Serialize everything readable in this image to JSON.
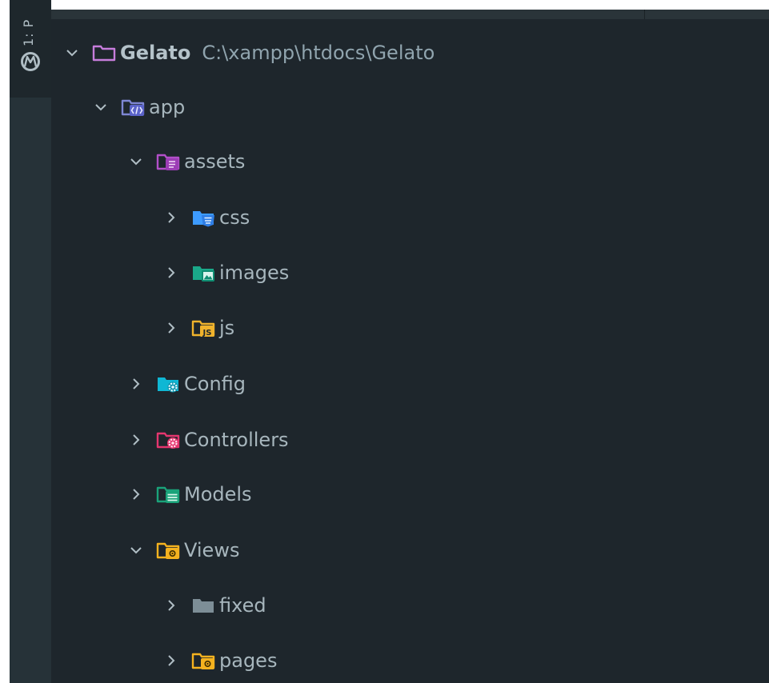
{
  "sidebar": {
    "tab_label": "1: P",
    "colors": {
      "bg": "#263238",
      "icon": "#b0bec5"
    }
  },
  "tree": {
    "colors": {
      "bg": "#1e262c",
      "text": "#a7b6bd",
      "chevron": "#b0bec5"
    },
    "root": {
      "name": "Gelato",
      "path": "C:\\xampp\\htdocs\\Gelato",
      "expanded": true,
      "icon": "folder-outline-icon",
      "icon_color": "#c77ddc"
    },
    "items": [
      {
        "name": "app",
        "expanded": true,
        "icon": "code-folder-icon",
        "icon_color": "#7e86d4"
      },
      {
        "name": "assets",
        "expanded": true,
        "icon": "assets-folder-icon",
        "icon_color": "#b24fc9"
      },
      {
        "name": "css",
        "expanded": false,
        "icon": "css-folder-icon",
        "icon_color": "#3d9bff"
      },
      {
        "name": "images",
        "expanded": false,
        "icon": "images-folder-icon",
        "icon_color": "#1aa889"
      },
      {
        "name": "js",
        "expanded": false,
        "icon": "js-folder-icon",
        "icon_color": "#f0b32c"
      },
      {
        "name": "Config",
        "expanded": false,
        "icon": "config-folder-icon",
        "icon_color": "#0fb7d4"
      },
      {
        "name": "Controllers",
        "expanded": false,
        "icon": "controllers-folder-icon",
        "icon_color": "#e4366f"
      },
      {
        "name": "Models",
        "expanded": false,
        "icon": "models-folder-icon",
        "icon_color": "#1aa37a"
      },
      {
        "name": "Views",
        "expanded": true,
        "icon": "views-folder-icon",
        "icon_color": "#f5b21f"
      },
      {
        "name": "fixed",
        "expanded": false,
        "icon": "folder-icon",
        "icon_color": "#7d8e97"
      },
      {
        "name": "pages",
        "expanded": false,
        "icon": "views-folder-icon",
        "icon_color": "#f5b21f"
      }
    ]
  }
}
